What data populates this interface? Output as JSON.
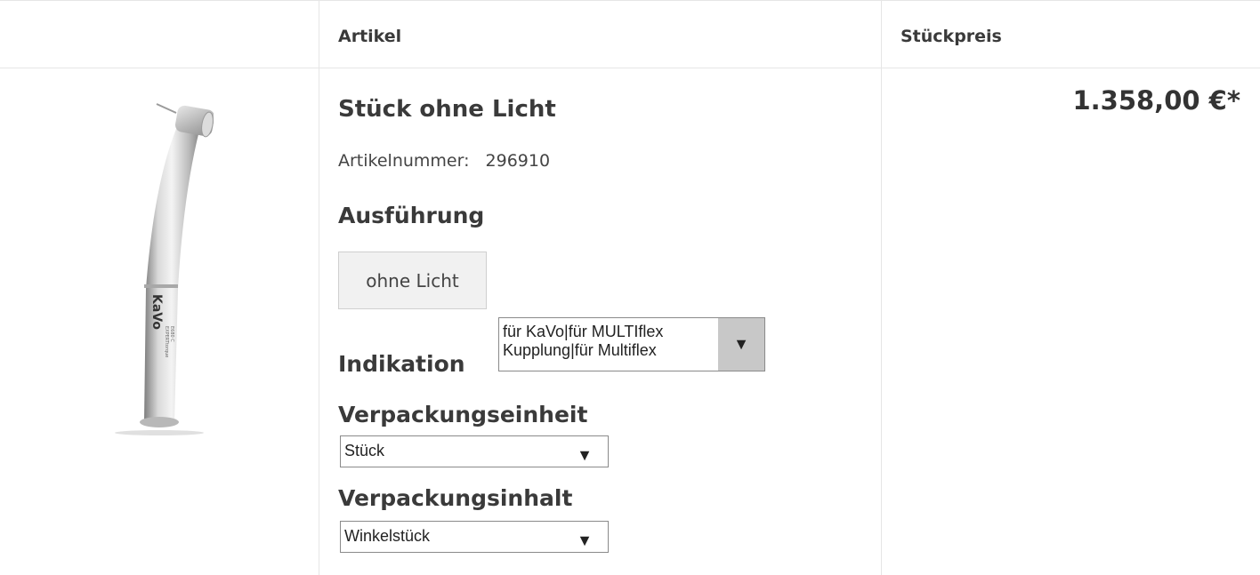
{
  "table": {
    "header_artikel": "Artikel",
    "header_stueckpreis": "Stückpreis"
  },
  "product": {
    "title": "Stück ohne Licht",
    "article_number_label": "Artikelnummer:",
    "article_number": "296910",
    "image_brand": "KaVo",
    "image_model": "EXPERTtorque E680 C",
    "price": "1.358,00 €*"
  },
  "ausfuehrung": {
    "label": "Ausführung",
    "option": "ohne Licht"
  },
  "indikation": {
    "label": "Indikation",
    "selected": "für KaVo|für MULTIflex\nKupplung|für Multiflex"
  },
  "verpackungseinheit": {
    "label": "Verpackungseinheit",
    "selected": "Stück"
  },
  "verpackungsinhalt": {
    "label": "Verpackungsinhalt",
    "selected": "Winkelstück"
  },
  "icons": {
    "dropdown_arrow": "▼"
  }
}
